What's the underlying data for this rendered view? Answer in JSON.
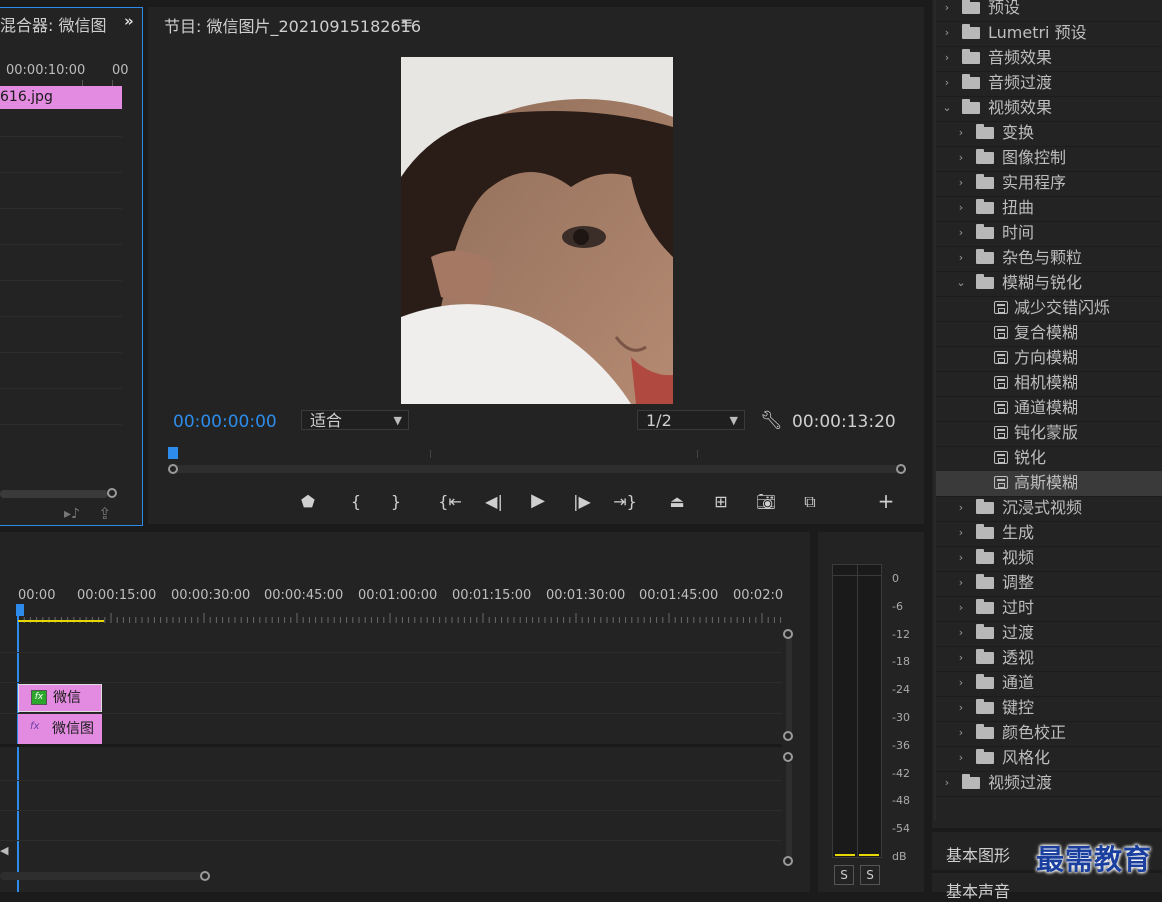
{
  "source_panel": {
    "title": "混合器: 微信图",
    "timecode_visible": "00:00:10:00",
    "timecode_partial": "00",
    "clip_label": "616.jpg"
  },
  "program_monitor": {
    "title": "节目: 微信图片_20210915182616",
    "current_time": "00:00:00:00",
    "zoom_label": "适合",
    "resolution_label": "1/2",
    "duration": "00:00:13:20"
  },
  "timeline": {
    "ruler_labels": [
      "00:00",
      "00:00:15:00",
      "00:00:30:00",
      "00:00:45:00",
      "00:01:00:00",
      "00:01:15:00",
      "00:01:30:00",
      "00:01:45:00",
      "00:02:0"
    ],
    "clip_video_top": "微信",
    "clip_video_bottom": "微信图"
  },
  "audio_meter": {
    "scale": [
      "0",
      "-6",
      "-12",
      "-18",
      "-24",
      "-30",
      "-36",
      "-42",
      "-48",
      "-54",
      "dB"
    ],
    "solo_left": "S",
    "solo_right": "S"
  },
  "effects_panel": {
    "items": [
      {
        "label": "预设",
        "level": 0,
        "type": "folder",
        "expanded": false
      },
      {
        "label": "Lumetri 预设",
        "level": 0,
        "type": "folder-star",
        "expanded": false
      },
      {
        "label": "音频效果",
        "level": 0,
        "type": "folder",
        "expanded": false
      },
      {
        "label": "音频过渡",
        "level": 0,
        "type": "folder",
        "expanded": false
      },
      {
        "label": "视频效果",
        "level": 0,
        "type": "folder",
        "expanded": true
      },
      {
        "label": "变换",
        "level": 1,
        "type": "folder",
        "expanded": false
      },
      {
        "label": "图像控制",
        "level": 1,
        "type": "folder",
        "expanded": false
      },
      {
        "label": "实用程序",
        "level": 1,
        "type": "folder",
        "expanded": false
      },
      {
        "label": "扭曲",
        "level": 1,
        "type": "folder",
        "expanded": false
      },
      {
        "label": "时间",
        "level": 1,
        "type": "folder",
        "expanded": false
      },
      {
        "label": "杂色与颗粒",
        "level": 1,
        "type": "folder",
        "expanded": false
      },
      {
        "label": "模糊与锐化",
        "level": 1,
        "type": "folder",
        "expanded": true
      },
      {
        "label": "减少交错闪烁",
        "level": 2,
        "type": "effect"
      },
      {
        "label": "复合模糊",
        "level": 2,
        "type": "effect"
      },
      {
        "label": "方向模糊",
        "level": 2,
        "type": "effect"
      },
      {
        "label": "相机模糊",
        "level": 2,
        "type": "effect"
      },
      {
        "label": "通道模糊",
        "level": 2,
        "type": "effect"
      },
      {
        "label": "钝化蒙版",
        "level": 2,
        "type": "effect"
      },
      {
        "label": "锐化",
        "level": 2,
        "type": "effect"
      },
      {
        "label": "高斯模糊",
        "level": 2,
        "type": "effect",
        "selected": true
      },
      {
        "label": "沉浸式视频",
        "level": 1,
        "type": "folder",
        "expanded": false
      },
      {
        "label": "生成",
        "level": 1,
        "type": "folder",
        "expanded": false
      },
      {
        "label": "视频",
        "level": 1,
        "type": "folder",
        "expanded": false
      },
      {
        "label": "调整",
        "level": 1,
        "type": "folder",
        "expanded": false
      },
      {
        "label": "过时",
        "level": 1,
        "type": "folder",
        "expanded": false
      },
      {
        "label": "过渡",
        "level": 1,
        "type": "folder",
        "expanded": false
      },
      {
        "label": "透视",
        "level": 1,
        "type": "folder",
        "expanded": false
      },
      {
        "label": "通道",
        "level": 1,
        "type": "folder",
        "expanded": false
      },
      {
        "label": "键控",
        "level": 1,
        "type": "folder",
        "expanded": false
      },
      {
        "label": "颜色校正",
        "level": 1,
        "type": "folder",
        "expanded": false
      },
      {
        "label": "风格化",
        "level": 1,
        "type": "folder",
        "expanded": false
      },
      {
        "label": "视频过渡",
        "level": 0,
        "type": "folder",
        "expanded": false
      }
    ],
    "bottom_tabs": [
      "基本图形",
      "基本声音"
    ]
  },
  "watermark": "最需教育",
  "colors": {
    "accent_blue": "#2d8ceb",
    "clip_pink": "#e38be0",
    "playhead_blue": "#2d8ceb",
    "in_out_yellow": "#e6d800",
    "selected_row": "#3a3a3a"
  }
}
